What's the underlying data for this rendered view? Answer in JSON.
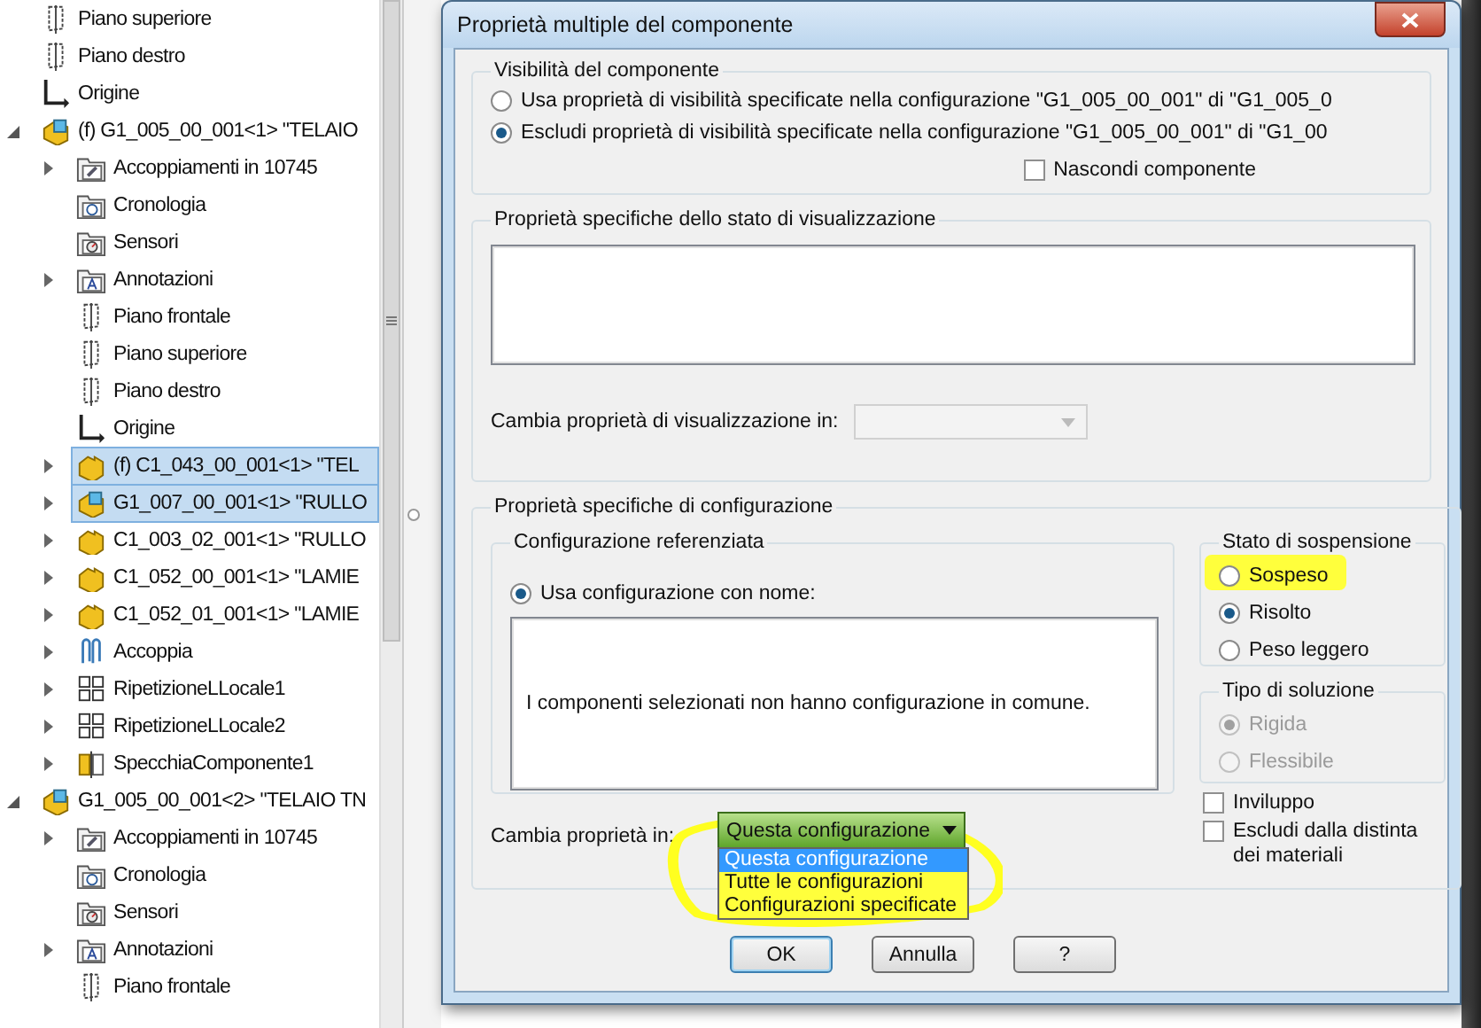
{
  "tree": [
    {
      "label": "Piano superiore",
      "kind": "plane",
      "expandable": false,
      "selected": false
    },
    {
      "label": "Piano destro",
      "kind": "plane",
      "expandable": false,
      "selected": false
    },
    {
      "label": "Origine",
      "kind": "origin",
      "expandable": false,
      "selected": false
    },
    {
      "label": "(f) G1_005_00_001<1> \"TELAIO",
      "kind": "assembly",
      "expandable": true,
      "expanded": true,
      "selected": false,
      "children": [
        {
          "label": "Accoppiamenti in 10745",
          "kind": "mates-folder",
          "expandable": true,
          "expanded": false,
          "selected": false
        },
        {
          "label": "Cronologia",
          "kind": "history-folder",
          "expandable": false,
          "selected": false
        },
        {
          "label": "Sensori",
          "kind": "sensor-folder",
          "expandable": false,
          "selected": false
        },
        {
          "label": "Annotazioni",
          "kind": "annotation-folder",
          "expandable": true,
          "expanded": false,
          "selected": false
        },
        {
          "label": "Piano frontale",
          "kind": "plane",
          "expandable": false,
          "selected": false
        },
        {
          "label": "Piano superiore",
          "kind": "plane",
          "expandable": false,
          "selected": false
        },
        {
          "label": "Piano destro",
          "kind": "plane",
          "expandable": false,
          "selected": false
        },
        {
          "label": "Origine",
          "kind": "origin",
          "expandable": false,
          "selected": false
        },
        {
          "label": "(f) C1_043_00_001<1> \"TEL",
          "kind": "part",
          "expandable": true,
          "expanded": false,
          "selected": true
        },
        {
          "label": "G1_007_00_001<1> \"RULLO",
          "kind": "assembly",
          "expandable": true,
          "expanded": false,
          "selected": true
        },
        {
          "label": "C1_003_02_001<1> \"RULLO",
          "kind": "part",
          "expandable": true,
          "expanded": false,
          "selected": false
        },
        {
          "label": "C1_052_00_001<1> \"LAMIE",
          "kind": "part",
          "expandable": true,
          "expanded": false,
          "selected": false
        },
        {
          "label": "C1_052_01_001<1> \"LAMIE",
          "kind": "part",
          "expandable": true,
          "expanded": false,
          "selected": false
        },
        {
          "label": "Accoppia",
          "kind": "mates",
          "expandable": true,
          "expanded": false,
          "selected": false
        },
        {
          "label": "RipetizioneLLocale1",
          "kind": "pattern",
          "expandable": true,
          "expanded": false,
          "selected": false
        },
        {
          "label": "RipetizioneLLocale2",
          "kind": "pattern",
          "expandable": true,
          "expanded": false,
          "selected": false
        },
        {
          "label": "SpecchiaComponente1",
          "kind": "mirror",
          "expandable": true,
          "expanded": false,
          "selected": false
        }
      ]
    },
    {
      "label": "G1_005_00_001<2> \"TELAIO TN",
      "kind": "assembly",
      "expandable": true,
      "expanded": true,
      "selected": false,
      "children": [
        {
          "label": "Accoppiamenti in 10745",
          "kind": "mates-folder",
          "expandable": true,
          "expanded": false,
          "selected": false
        },
        {
          "label": "Cronologia",
          "kind": "history-folder",
          "expandable": false,
          "selected": false
        },
        {
          "label": "Sensori",
          "kind": "sensor-folder",
          "expandable": false,
          "selected": false
        },
        {
          "label": "Annotazioni",
          "kind": "annotation-folder",
          "expandable": true,
          "expanded": false,
          "selected": false
        },
        {
          "label": "Piano frontale",
          "kind": "plane",
          "expandable": false,
          "selected": false
        }
      ]
    }
  ],
  "dialog": {
    "title": "Proprietà multiple del componente",
    "visibility": {
      "title": "Visibilità del componente",
      "options": [
        {
          "label": "Usa proprietà di visibilità specificate nella configurazione \"G1_005_00_001\" di \"G1_005_0",
          "selected": false
        },
        {
          "label": "Escludi proprietà di visibilità specificate nella configurazione \"G1_005_00_001\" di \"G1_00",
          "selected": true
        }
      ],
      "hide": {
        "label": "Nascondi componente",
        "checked": false
      }
    },
    "display_state": {
      "title": "Proprietà specifiche dello stato di visualizzazione",
      "change_label": "Cambia proprietà di visualizzazione in:",
      "dropdown_disabled": true
    },
    "configuration": {
      "title": "Proprietà specifiche di configurazione",
      "referenced": {
        "title": "Configurazione referenziata",
        "option": {
          "label": "Usa configurazione con nome:",
          "selected": true
        },
        "message": "I componenti selezionati non hanno configurazione in comune."
      },
      "change_label": "Cambia proprietà in:",
      "dropdown": {
        "value": "Questa configurazione",
        "open": true,
        "options": [
          {
            "label": "Questa configurazione",
            "selected": true
          },
          {
            "label": "Tutte le configurazioni",
            "selected": false
          },
          {
            "label": "Configurazioni specificate",
            "selected": false
          }
        ]
      },
      "suspension": {
        "title": "Stato di sospensione",
        "options": [
          {
            "label": "Sospeso",
            "selected": false
          },
          {
            "label": "Risolto",
            "selected": true
          },
          {
            "label": "Peso leggero",
            "selected": false
          }
        ]
      },
      "solution": {
        "title": "Tipo di soluzione",
        "disabled": true,
        "options": [
          {
            "label": "Rigida",
            "selected": true
          },
          {
            "label": "Flessibile",
            "selected": false
          }
        ]
      },
      "checkboxes": [
        {
          "label": "Inviluppo",
          "checked": false
        },
        {
          "label": "Escludi dalla distinta dei materiali",
          "checked": false
        }
      ]
    },
    "buttons": [
      {
        "label": "OK",
        "focused": true
      },
      {
        "label": "Annulla",
        "focused": false
      },
      {
        "label": "?",
        "focused": false
      }
    ]
  }
}
